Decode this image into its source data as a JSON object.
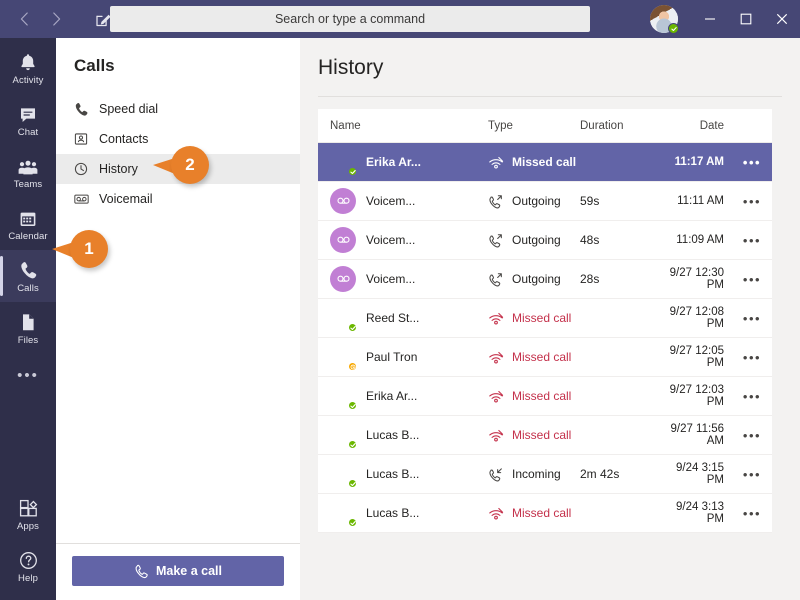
{
  "titlebar": {
    "back_icon": "chevron-left-icon",
    "forward_icon": "chevron-right-icon",
    "compose_icon": "compose-icon",
    "search_placeholder": "Search or type a command",
    "search_value": "",
    "minimize_label": "—",
    "maximize_label": "□",
    "close_label": "✕",
    "user_presence": "available"
  },
  "rail": {
    "items": [
      {
        "label": "Activity",
        "icon": "bell-icon",
        "active": false
      },
      {
        "label": "Chat",
        "icon": "chat-icon",
        "active": false
      },
      {
        "label": "Teams",
        "icon": "teams-icon",
        "active": false
      },
      {
        "label": "Calendar",
        "icon": "calendar-icon",
        "active": false
      },
      {
        "label": "Calls",
        "icon": "phone-icon",
        "active": true
      },
      {
        "label": "Files",
        "icon": "file-icon",
        "active": false
      }
    ],
    "more_label": "•••",
    "bottom": [
      {
        "label": "Apps",
        "icon": "apps-icon"
      },
      {
        "label": "Help",
        "icon": "help-icon"
      }
    ]
  },
  "calls_panel": {
    "title": "Calls",
    "items": [
      {
        "label": "Speed dial",
        "icon": "phone-icon",
        "selected": false
      },
      {
        "label": "Contacts",
        "icon": "contact-card-icon",
        "selected": false
      },
      {
        "label": "History",
        "icon": "clock-icon",
        "selected": true
      },
      {
        "label": "Voicemail",
        "icon": "voicemail-icon",
        "selected": false
      }
    ],
    "make_call_label": "Make a call",
    "make_call_icon": "phone-icon"
  },
  "main": {
    "title": "History",
    "columns": [
      "Name",
      "Type",
      "Duration",
      "Date"
    ],
    "menu_glyph": "•••",
    "rows": [
      {
        "name": "Erika Ar...",
        "type": "Missed call",
        "type_icon": "missed-call-icon",
        "missed": true,
        "duration": "",
        "date": "11:17 AM",
        "avatar": "photo",
        "face": "face-erika",
        "presence": "available",
        "selected": true
      },
      {
        "name": "Voicem...",
        "type": "Outgoing",
        "type_icon": "outgoing-call-icon",
        "missed": false,
        "duration": "59s",
        "date": "11:11 AM",
        "avatar": "voicemail",
        "face": "",
        "presence": "",
        "selected": false
      },
      {
        "name": "Voicem...",
        "type": "Outgoing",
        "type_icon": "outgoing-call-icon",
        "missed": false,
        "duration": "48s",
        "date": "11:09 AM",
        "avatar": "voicemail",
        "face": "",
        "presence": "",
        "selected": false
      },
      {
        "name": "Voicem...",
        "type": "Outgoing",
        "type_icon": "outgoing-call-icon",
        "missed": false,
        "duration": "28s",
        "date": "9/27 12:30 PM",
        "avatar": "voicemail",
        "face": "",
        "presence": "",
        "selected": false
      },
      {
        "name": "Reed St...",
        "type": "Missed call",
        "type_icon": "missed-call-icon",
        "missed": true,
        "duration": "",
        "date": "9/27 12:08 PM",
        "avatar": "photo",
        "face": "face-reed",
        "presence": "available",
        "selected": false
      },
      {
        "name": "Paul Tron",
        "type": "Missed call",
        "type_icon": "missed-call-icon",
        "missed": true,
        "duration": "",
        "date": "9/27 12:05 PM",
        "avatar": "photo",
        "face": "face-paul",
        "presence": "away",
        "selected": false
      },
      {
        "name": "Erika Ar...",
        "type": "Missed call",
        "type_icon": "missed-call-icon",
        "missed": true,
        "duration": "",
        "date": "9/27 12:03 PM",
        "avatar": "photo",
        "face": "face-me",
        "presence": "available",
        "selected": false
      },
      {
        "name": "Lucas B...",
        "type": "Missed call",
        "type_icon": "missed-call-icon",
        "missed": true,
        "duration": "",
        "date": "9/27 11:56 AM",
        "avatar": "photo",
        "face": "face-lucas",
        "presence": "available",
        "selected": false
      },
      {
        "name": "Lucas B...",
        "type": "Incoming",
        "type_icon": "incoming-call-icon",
        "missed": false,
        "duration": "2m 42s",
        "date": "9/24 3:15 PM",
        "avatar": "photo",
        "face": "face-lucas",
        "presence": "available",
        "selected": false
      },
      {
        "name": "Lucas B...",
        "type": "Missed call",
        "type_icon": "missed-call-icon",
        "missed": true,
        "duration": "",
        "date": "9/24 3:13 PM",
        "avatar": "photo",
        "face": "face-lucas",
        "presence": "available",
        "selected": false
      }
    ]
  },
  "callouts": [
    {
      "number": "1"
    },
    {
      "number": "2"
    }
  ],
  "colors": {
    "brand_purple": "#6264a7",
    "titlebar_purple": "#464775",
    "rail_dark": "#2f2f4a",
    "callout_orange": "#e8802a",
    "missed_red": "#c4314b",
    "available_green": "#6bb700",
    "away_amber": "#f8a800",
    "voicemail_avatar": "#c17fd4"
  }
}
